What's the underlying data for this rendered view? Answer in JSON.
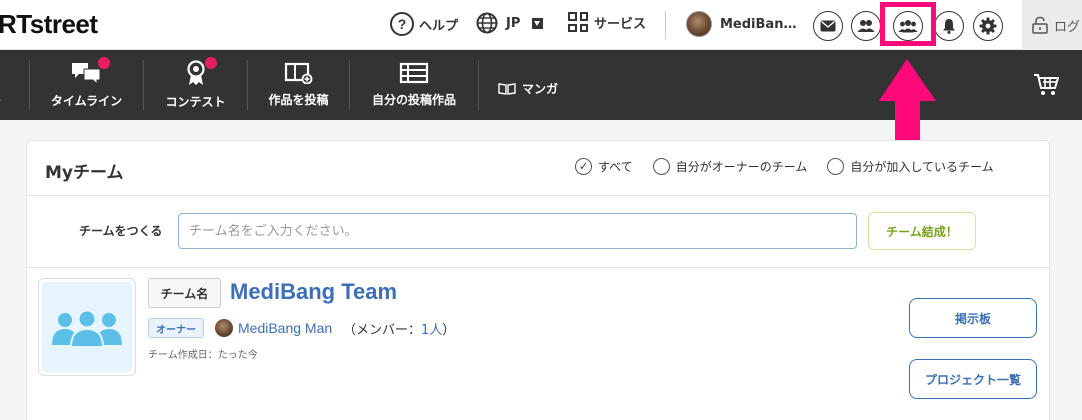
{
  "header": {
    "logo": "RTstreet",
    "help_label": "ヘルプ",
    "lang_label": "JP",
    "services_label": "サービス",
    "user_name": "MediBan…",
    "login_label": "ログ",
    "highlight_color": "#ff0a78"
  },
  "nav": {
    "items": [
      {
        "label": "ト"
      },
      {
        "label": "タイムライン"
      },
      {
        "label": "コンテスト"
      },
      {
        "label": "作品を投稿"
      },
      {
        "label": "自分の投稿作品"
      }
    ],
    "manga_label": "マンガ"
  },
  "panel": {
    "title": "Myチーム",
    "filters": [
      {
        "label": "すべて",
        "checked": true
      },
      {
        "label": "自分がオーナーのチーム",
        "checked": false
      },
      {
        "label": "自分が加入しているチーム",
        "checked": false
      }
    ],
    "create_label": "チームをつくる",
    "create_placeholder": "チーム名をご入力ください。",
    "create_button": "チーム結成！"
  },
  "team": {
    "tag": "チーム名",
    "name": "MediBang Team",
    "owner_badge": "オーナー",
    "owner_name": "MediBang Man",
    "members_prefix": "（メンバー：",
    "members_count": "1人",
    "members_suffix": "）",
    "created": "チーム作成日：たった今",
    "board_button": "掲示板",
    "projects_button": "プロジェクト一覧"
  },
  "colors": {
    "accent_blue": "#3d6fb6",
    "badge_pink": "#e91e63",
    "create_green": "#7aa21e"
  }
}
